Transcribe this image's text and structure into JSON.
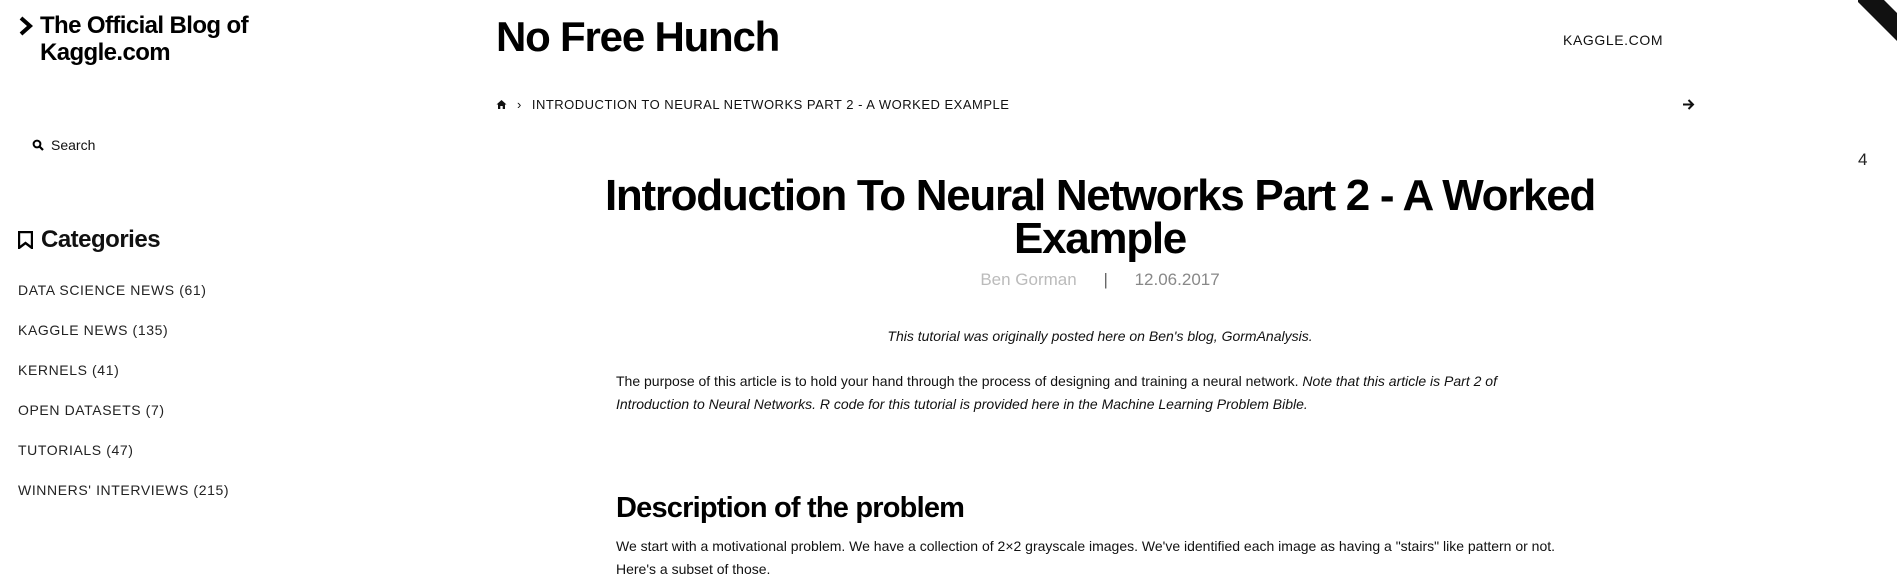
{
  "sidebar": {
    "blog_title": "The Official Blog of Kaggle.com",
    "search_label": "Search",
    "categories_heading": "Categories",
    "categories": [
      {
        "label": "DATA SCIENCE NEWS (61)"
      },
      {
        "label": "KAGGLE NEWS (135)"
      },
      {
        "label": "KERNELS (41)"
      },
      {
        "label": "OPEN DATASETS (7)"
      },
      {
        "label": "TUTORIALS (47)"
      },
      {
        "label": "WINNERS' INTERVIEWS (215)"
      }
    ]
  },
  "header": {
    "site_title": "No Free Hunch",
    "top_link": "KAGGLE.COM"
  },
  "breadcrumb": {
    "current": "INTRODUCTION TO NEURAL NETWORKS PART 2 - A WORKED EXAMPLE"
  },
  "page_count": "4",
  "post": {
    "title": "Introduction To Neural Networks Part 2 - A Worked Example",
    "author": "Ben Gorman",
    "date": "12.06.2017",
    "intro_note": "This tutorial was originally posted here on Ben's blog, GormAnalysis.",
    "paragraph1_plain": "The purpose of this article is to hold your hand through the process of designing and training a neural network.",
    "paragraph1_italic": "Note that this article is Part 2 of Introduction to Neural Networks. R code for this tutorial is provided here in the Machine Learning Problem Bible.",
    "section_heading": "Description of the problem",
    "paragraph2": "We start with a motivational problem. We have a collection of 2×2 grayscale images. We've identified each image as having a \"stairs\" like pattern or not. Here's a subset of those."
  },
  "colors": {
    "background": "#ffffff",
    "text": "#111111",
    "meta": "#888888"
  }
}
